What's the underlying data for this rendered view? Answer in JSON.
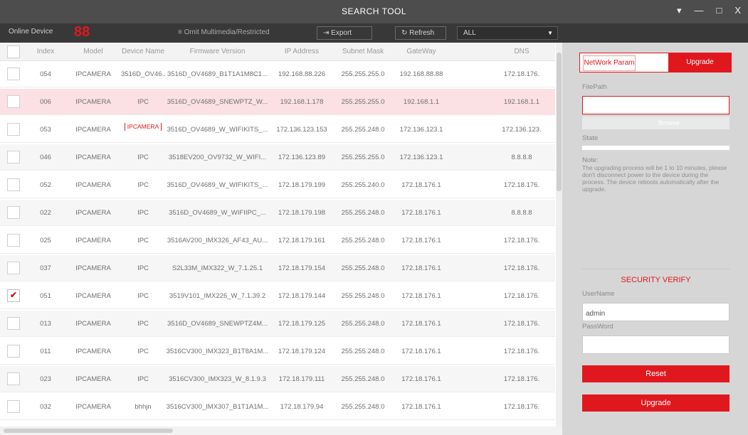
{
  "window": {
    "title": "SEARCH TOOL",
    "buttons": {
      "menu": "▾",
      "minimize": "—",
      "maximize": "□",
      "close": "X"
    }
  },
  "toolbar": {
    "online_label": "Online Device",
    "online_count": "88",
    "multicast_label": "Omit Multimedia/Restricted",
    "export_label": "Export",
    "refresh_label": "Refresh",
    "filter_value": "ALL"
  },
  "table": {
    "headers": [
      "Index",
      "Model",
      "Device Name",
      "Firmware Version",
      "IP Address",
      "Subnet Mask",
      "GateWay",
      "DNS"
    ],
    "rows": [
      {
        "index": "054",
        "model": "IPCAMERA",
        "name": "3516D_OV46...",
        "fw": "3516D_OV4689_B1T1A1M8C1...",
        "ip": "192.168.88.226",
        "mask": "255.255.255.0",
        "gw": "192.168.88.88",
        "dns": "172.18.176.",
        "checked": false,
        "selected": false,
        "editing": false
      },
      {
        "index": "006",
        "model": "IPCAMERA",
        "name": "IPC",
        "fw": "3516D_OV4689_SNEWPTZ_W...",
        "ip": "192.168.1.178",
        "mask": "255.255.255.0",
        "gw": "192.168.1.1",
        "dns": "192.168.1.1",
        "checked": false,
        "selected": true,
        "editing": false
      },
      {
        "index": "053",
        "model": "IPCAMERA",
        "name": "IPCAMERA",
        "fw": "3516D_OV4689_W_WIFIKITS_...",
        "ip": "172.136.123.153",
        "mask": "255.255.248.0",
        "gw": "172.136.123.1",
        "dns": "172.136.123.",
        "checked": false,
        "selected": false,
        "editing": true
      },
      {
        "index": "046",
        "model": "IPCAMERA",
        "name": "IPC",
        "fw": "3518EV200_OV9732_W_WIFI...",
        "ip": "172.136.123.89",
        "mask": "255.255.255.0",
        "gw": "172.136.123.1",
        "dns": "8.8.8.8",
        "checked": false,
        "selected": false,
        "editing": false
      },
      {
        "index": "052",
        "model": "IPCAMERA",
        "name": "IPC",
        "fw": "3516D_OV4689_W_WIFIKITS_...",
        "ip": "172.18.179.199",
        "mask": "255.255.240.0",
        "gw": "172.18.176.1",
        "dns": "172.18.176.",
        "checked": false,
        "selected": false,
        "editing": false
      },
      {
        "index": "022",
        "model": "IPCAMERA",
        "name": "IPC",
        "fw": "3516D_OV4689_W_WIFIIPC_...",
        "ip": "172.18.179.198",
        "mask": "255.255.248.0",
        "gw": "172.18.176.1",
        "dns": "8.8.8.8",
        "checked": false,
        "selected": false,
        "editing": false
      },
      {
        "index": "025",
        "model": "IPCAMERA",
        "name": "IPC",
        "fw": "3516AV200_IMX326_AF43_AU...",
        "ip": "172.18.179.161",
        "mask": "255.255.248.0",
        "gw": "172.18.176.1",
        "dns": "172.18.176.",
        "checked": false,
        "selected": false,
        "editing": false
      },
      {
        "index": "037",
        "model": "IPCAMERA",
        "name": "IPC",
        "fw": "S2L33M_IMX322_W_7.1.25.1",
        "ip": "172.18.179.154",
        "mask": "255.255.248.0",
        "gw": "172.18.176.1",
        "dns": "172.18.176.",
        "checked": false,
        "selected": false,
        "editing": false
      },
      {
        "index": "051",
        "model": "IPCAMERA",
        "name": "IPC",
        "fw": "3519V101_IMX226_W_7.1.39.2",
        "ip": "172.18.179.144",
        "mask": "255.255.248.0",
        "gw": "172.18.176.1",
        "dns": "172.18.176.",
        "checked": true,
        "selected": false,
        "editing": false
      },
      {
        "index": "013",
        "model": "IPCAMERA",
        "name": "IPC",
        "fw": "3516D_OV4689_SNEWPTZ4M...",
        "ip": "172.18.179.125",
        "mask": "255.255.248.0",
        "gw": "172.18.176.1",
        "dns": "172.18.176.",
        "checked": false,
        "selected": false,
        "editing": false
      },
      {
        "index": "011",
        "model": "IPCAMERA",
        "name": "IPC",
        "fw": "3516CV300_IMX323_B1T8A1M...",
        "ip": "172.18.179.124",
        "mask": "255.255.248.0",
        "gw": "172.18.176.1",
        "dns": "172.18.176.",
        "checked": false,
        "selected": false,
        "editing": false
      },
      {
        "index": "023",
        "model": "IPCAMERA",
        "name": "IPC",
        "fw": "3516CV300_IMX323_W_8.1.9.3",
        "ip": "172.18.179.111",
        "mask": "255.255.248.0",
        "gw": "172.18.176.1",
        "dns": "172.18.176.",
        "checked": false,
        "selected": false,
        "editing": false
      },
      {
        "index": "032",
        "model": "IPCAMERA",
        "name": "bhhjn",
        "fw": "3516CV300_IMX307_B1T1A1M...",
        "ip": "172.18.179.94",
        "mask": "255.255.248.0",
        "gw": "172.18.176.1",
        "dns": "172.18.176.",
        "checked": false,
        "selected": false,
        "editing": false
      }
    ]
  },
  "panel": {
    "tab_network": "NetWork Param",
    "tab_upgrade": "Upgrade",
    "filepath_label": "FilePath",
    "browse_label": "Browse",
    "state_label": "State",
    "note_label": "Note:",
    "note_text": "The upgrading process will be 1 to 10 minutes, please don't disconnect power to the device during the process. The device reboots automatically after the upgrade.",
    "security_title": "SECURITY VERIFY",
    "username_label": "UserName",
    "username_value": "admin",
    "password_label": "PassWord",
    "password_value": "",
    "reset_label": "Reset",
    "upgrade_label": "Upgrade"
  },
  "colors": {
    "accent": "#e0181e",
    "titlebar": "#4d4d4d",
    "toolbar": "#383838",
    "panel": "#d6d6d6",
    "selected_row": "#fbe1e3"
  }
}
